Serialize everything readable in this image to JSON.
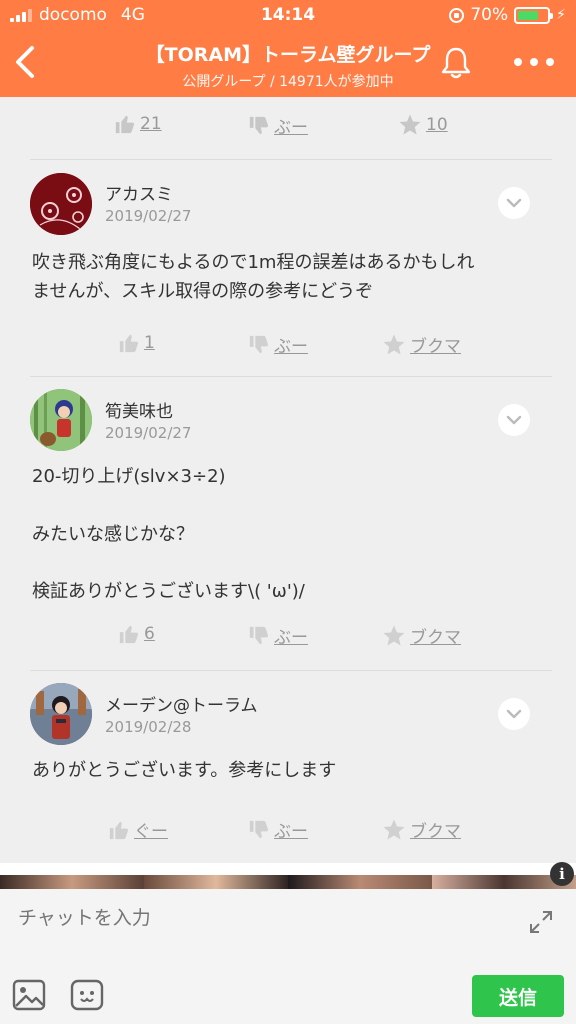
{
  "status_bar": {
    "carrier": "docomo",
    "network": "4G",
    "time": "14:14",
    "battery": "70%",
    "battery_level": 0.7
  },
  "header": {
    "title": "【TORAM】トーラム壁グループ",
    "subtitle": "公開グループ / 14971人が参加中"
  },
  "top_actions": {
    "like": "21",
    "dislike": "ぶー",
    "favorite": "10"
  },
  "comments": [
    {
      "name": "アカスミ",
      "date": "2019/02/27",
      "text": "吹き飛ぶ角度にもよるので1m程の誤差はあるかもしれ\nませんが、スキル取得の際の参考にどうぞ",
      "like": "1",
      "dislike": "ぶー",
      "bookmark": "ブクマ"
    },
    {
      "name": "筍美味也",
      "date": "2019/02/27",
      "text": "20-切り上げ(slv×3÷2)\n\nみたいな感じかな？\n\n検証ありがとうございます\\( 'ω')/",
      "like": "6",
      "dislike": "ぶー",
      "bookmark": "ブクマ"
    },
    {
      "name": "メーデン@トーラム",
      "date": "2019/02/28",
      "text": "ありがとうございます。参考にします",
      "like": "ぐー",
      "dislike": "ぶー",
      "bookmark": "ブクマ"
    }
  ],
  "chat": {
    "placeholder": "チャットを入力",
    "send_label": "送信"
  },
  "colors": {
    "header": "#ff7d45",
    "send": "#2fc44b",
    "battery": "#4cd964"
  }
}
